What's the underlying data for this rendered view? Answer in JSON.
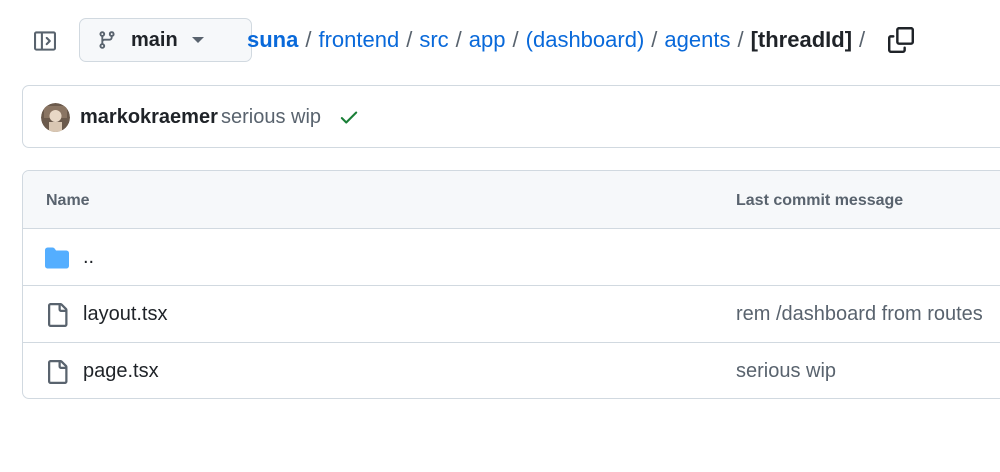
{
  "header": {
    "panel_icon": "sidebar-expand-icon",
    "branch": {
      "name": "main",
      "icon": "git-branch-icon",
      "caret_icon": "triangle-down-icon"
    },
    "breadcrumb": [
      "suna",
      "frontend",
      "src",
      "app",
      "(dashboard)",
      "agents",
      "[threadId]"
    ],
    "separator": "/",
    "copy_icon": "copy-icon"
  },
  "commit": {
    "author": "markokraemer",
    "message": "serious wip",
    "status_icon": "check-icon",
    "status_color": "#1a7f37"
  },
  "table": {
    "columns": [
      "Name",
      "Last commit message"
    ],
    "rows": [
      {
        "name": "..",
        "type": "folder",
        "message": ""
      },
      {
        "name": "layout.tsx",
        "type": "file",
        "message": "rem /dashboard from routes"
      },
      {
        "name": "page.tsx",
        "type": "file",
        "message": "serious wip"
      }
    ]
  },
  "colors": {
    "link": "#0969da",
    "folder": "#54aeff",
    "muted": "#59636e",
    "border": "#d1d9e0"
  }
}
